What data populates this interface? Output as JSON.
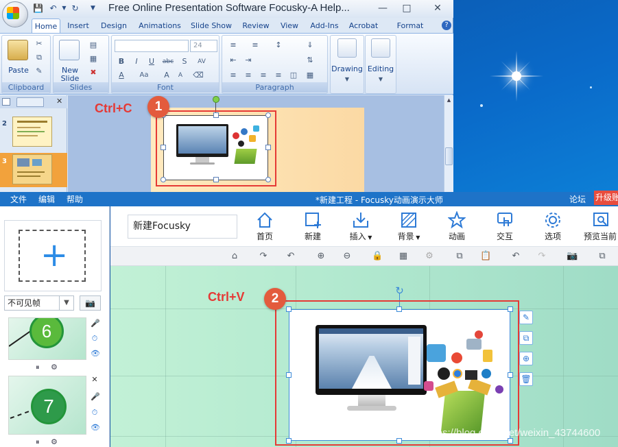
{
  "powerpoint": {
    "title": "Free Online Presentation Software Focusky-A Help...",
    "tabs": [
      "Home",
      "Insert",
      "Design",
      "Animations",
      "Slide Show",
      "Review",
      "View",
      "Add-Ins",
      "Acrobat",
      "Format"
    ],
    "groups": {
      "clipboard": {
        "label": "Clipboard",
        "paste": "Paste"
      },
      "slides": {
        "label": "Slides",
        "new_slide_line1": "New",
        "new_slide_line2": "Slide"
      },
      "font": {
        "label": "Font",
        "size": "24"
      },
      "paragraph": {
        "label": "Paragraph"
      },
      "drawing": {
        "label": "Drawing"
      },
      "editing": {
        "label": "Editing"
      }
    },
    "slide_thumbs": [
      "2",
      "3"
    ]
  },
  "annotations": {
    "step1_number": "1",
    "step1_shortcut": "Ctrl+C",
    "step2_number": "2",
    "step2_shortcut": "Ctrl+V"
  },
  "focusky": {
    "menu": [
      "文件",
      "编辑",
      "帮助"
    ],
    "title": "*新建工程 - Focusky动画演示大师",
    "forum": "论坛",
    "upgrade": "升级账",
    "project_name": "新建Focusky",
    "toolbar": [
      {
        "label": "首页",
        "icon": "home-icon"
      },
      {
        "label": "新建",
        "icon": "new-frame-icon"
      },
      {
        "label": "插入",
        "icon": "insert-icon"
      },
      {
        "label": "背景",
        "icon": "background-icon"
      },
      {
        "label": "动画",
        "icon": "animation-star-icon"
      },
      {
        "label": "交互",
        "icon": "interaction-hand-icon"
      },
      {
        "label": "选项",
        "icon": "settings-gear-icon"
      },
      {
        "label": "预览当前",
        "icon": "preview-icon"
      }
    ],
    "frame_visibility": "不可见帧",
    "frames": [
      {
        "number": "6"
      },
      {
        "number": "7"
      }
    ]
  },
  "watermark": "https://blog.csdn.net/weixin_43744600",
  "colors": {
    "accent_red": "#e53935",
    "focusky_blue": "#1e73c8",
    "step_badge": "#e35b3d"
  }
}
